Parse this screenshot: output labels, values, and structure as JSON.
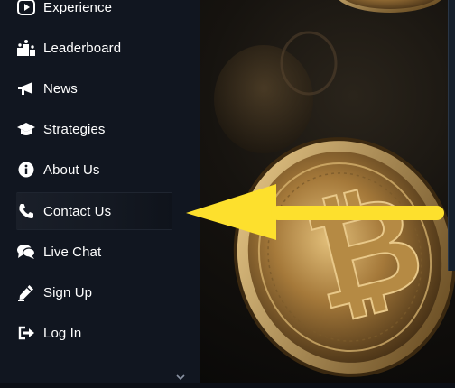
{
  "sidebar": {
    "items": [
      {
        "label": "Experience",
        "icon": "play-icon"
      },
      {
        "label": "Leaderboard",
        "icon": "podium-icon"
      },
      {
        "label": "News",
        "icon": "megaphone-icon"
      },
      {
        "label": "Strategies",
        "icon": "graduation-cap-icon"
      },
      {
        "label": "About Us",
        "icon": "info-icon"
      },
      {
        "label": "Contact Us",
        "icon": "phone-icon"
      },
      {
        "label": "Live Chat",
        "icon": "chat-icon"
      },
      {
        "label": "Sign Up",
        "icon": "pencil-icon"
      },
      {
        "label": "Log In",
        "icon": "login-icon"
      }
    ],
    "active_item": "Contact Us"
  },
  "colors": {
    "sidebar_bg": "#111620",
    "text": "#ffffff",
    "arrow": "#fde02d",
    "coin_gold": "#c9a25a"
  },
  "hero": {
    "image": "bitcoin-coins",
    "coin_symbol": "₿"
  }
}
